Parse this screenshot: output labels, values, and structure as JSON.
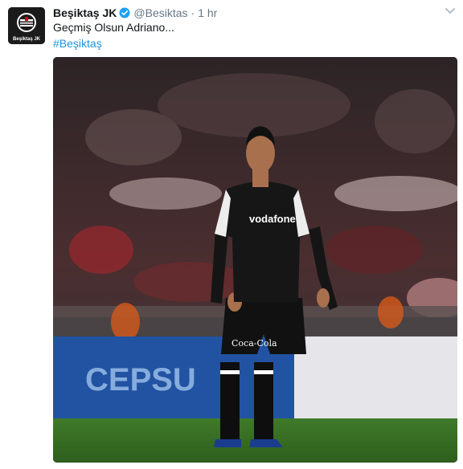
{
  "tweet": {
    "display_name": "Beşiktaş JK",
    "screen_name": "@Besiktas",
    "separator": "·",
    "timestamp": "1 hr",
    "text": "Geçmiş Olsun Adriano...",
    "hashtag": "#Beşiktaş",
    "verified_color": "#1da1f2",
    "hashtag_color": "#1b95e0"
  },
  "avatar": {
    "caption": "Beşiktaş JK"
  },
  "media": {
    "jersey_sponsor": "vodafone",
    "shorts_sponsor": "Coca-Cola",
    "board_text": "CEPSU"
  }
}
